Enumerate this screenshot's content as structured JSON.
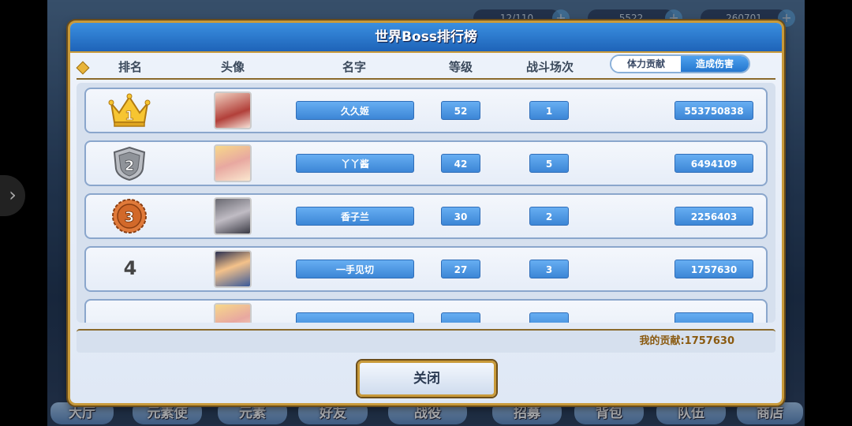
{
  "hud": {
    "stamina": "12/110",
    "gems": "5522",
    "gold": "260701"
  },
  "nav": [
    "大厅",
    "元素使",
    "元素",
    "好友",
    "战役",
    "招募",
    "背包",
    "队伍",
    "商店"
  ],
  "dialog": {
    "title": "世界Boss排行榜",
    "columns": {
      "rank": "排名",
      "avatar": "头像",
      "name": "名字",
      "level": "等级",
      "battles": "战斗场次"
    },
    "toggle": {
      "stamina_label": "体力贡献",
      "damage_label": "造成伤害",
      "selected": "造成伤害"
    },
    "rows": [
      {
        "rank": "1",
        "name": "久久姬",
        "level": "52",
        "battles": "1",
        "damage": "553750838"
      },
      {
        "rank": "2",
        "name": "丫丫酱",
        "level": "42",
        "battles": "5",
        "damage": "6494109"
      },
      {
        "rank": "3",
        "name": "香子兰",
        "level": "30",
        "battles": "2",
        "damage": "2256403"
      },
      {
        "rank": "4",
        "name": "一手见切",
        "level": "27",
        "battles": "3",
        "damage": "1757630"
      }
    ],
    "my_contribution": "我的贡献:1757630",
    "close_label": "关闭"
  }
}
